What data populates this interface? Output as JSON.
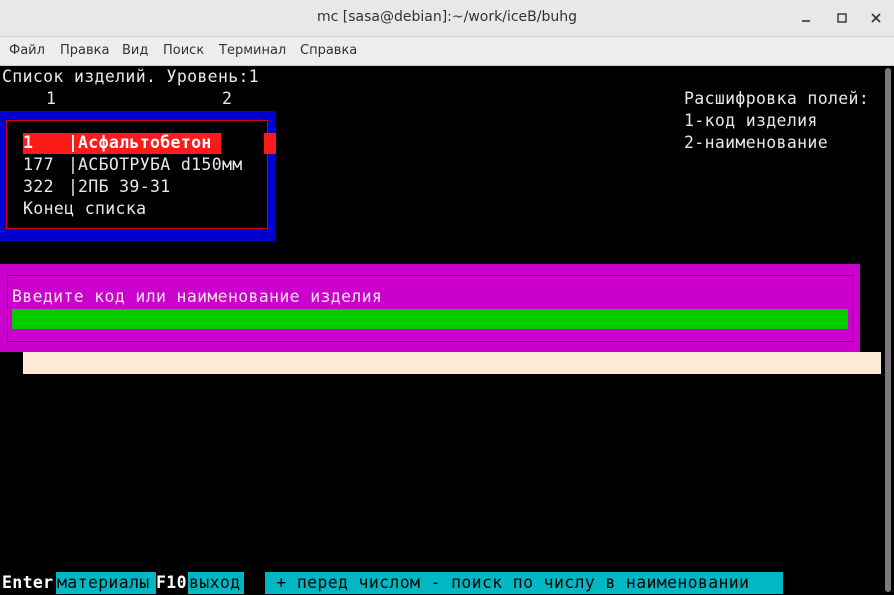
{
  "window": {
    "title": "mc [sasa@debian]:~/work/iceB/buhg"
  },
  "menu": [
    "Файл",
    "Правка",
    "Вид",
    "Поиск",
    "Терминал",
    "Справка"
  ],
  "screen": {
    "heading": "Список изделий. Уровень:1",
    "col_numbers": [
      "1",
      "2"
    ],
    "legend": {
      "title": "Расшифровка полей:",
      "items": [
        "1-код изделия",
        "2-наименование"
      ]
    },
    "list": [
      {
        "code": "1",
        "name": "Асфальтобетон",
        "selected": true
      },
      {
        "code": "177",
        "name": "АСБОТРУБА d150мм",
        "selected": false
      },
      {
        "code": "322",
        "name": "2ПБ 39-31",
        "selected": false
      }
    ],
    "list_end": "Конец списка",
    "separator": "|",
    "prompt": {
      "label": "Введите код или наименование изделия",
      "value": ""
    },
    "hints": [
      {
        "key": "Enter",
        "label": "материалы"
      },
      {
        "key": "F10",
        "label": "выход"
      }
    ],
    "hint_note": " + перед числом - поиск по числу в наименовании"
  },
  "colors": {
    "list_frame": "#0000d0",
    "selection": "#ff1a1a",
    "dialog": "#cc00cc",
    "input": "#00cc00",
    "hint_bar": "#00b8c4"
  }
}
